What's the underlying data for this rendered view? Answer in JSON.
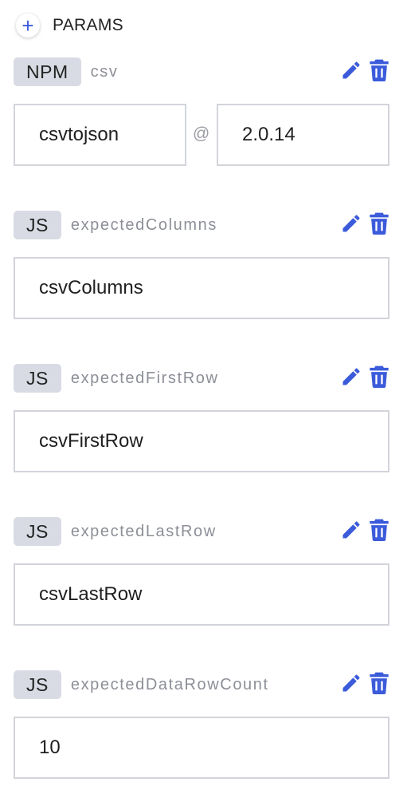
{
  "header": {
    "add_icon": "+",
    "title": "PARAMS"
  },
  "params": [
    {
      "type": "NPM",
      "name": "csv",
      "package": "csvtojson",
      "separator": "@",
      "version": "2.0.14"
    },
    {
      "type": "JS",
      "name": "expectedColumns",
      "value": "csvColumns"
    },
    {
      "type": "JS",
      "name": "expectedFirstRow",
      "value": "csvFirstRow"
    },
    {
      "type": "JS",
      "name": "expectedLastRow",
      "value": "csvLastRow"
    },
    {
      "type": "JS",
      "name": "expectedDataRowCount",
      "value": "10"
    }
  ],
  "icons": {
    "edit": "pencil-icon",
    "delete": "trash-icon"
  },
  "colors": {
    "accent": "#3b5bdb",
    "badge_bg": "#d8dbe3",
    "border": "#d2d4da",
    "muted_text": "#8c8f97"
  }
}
